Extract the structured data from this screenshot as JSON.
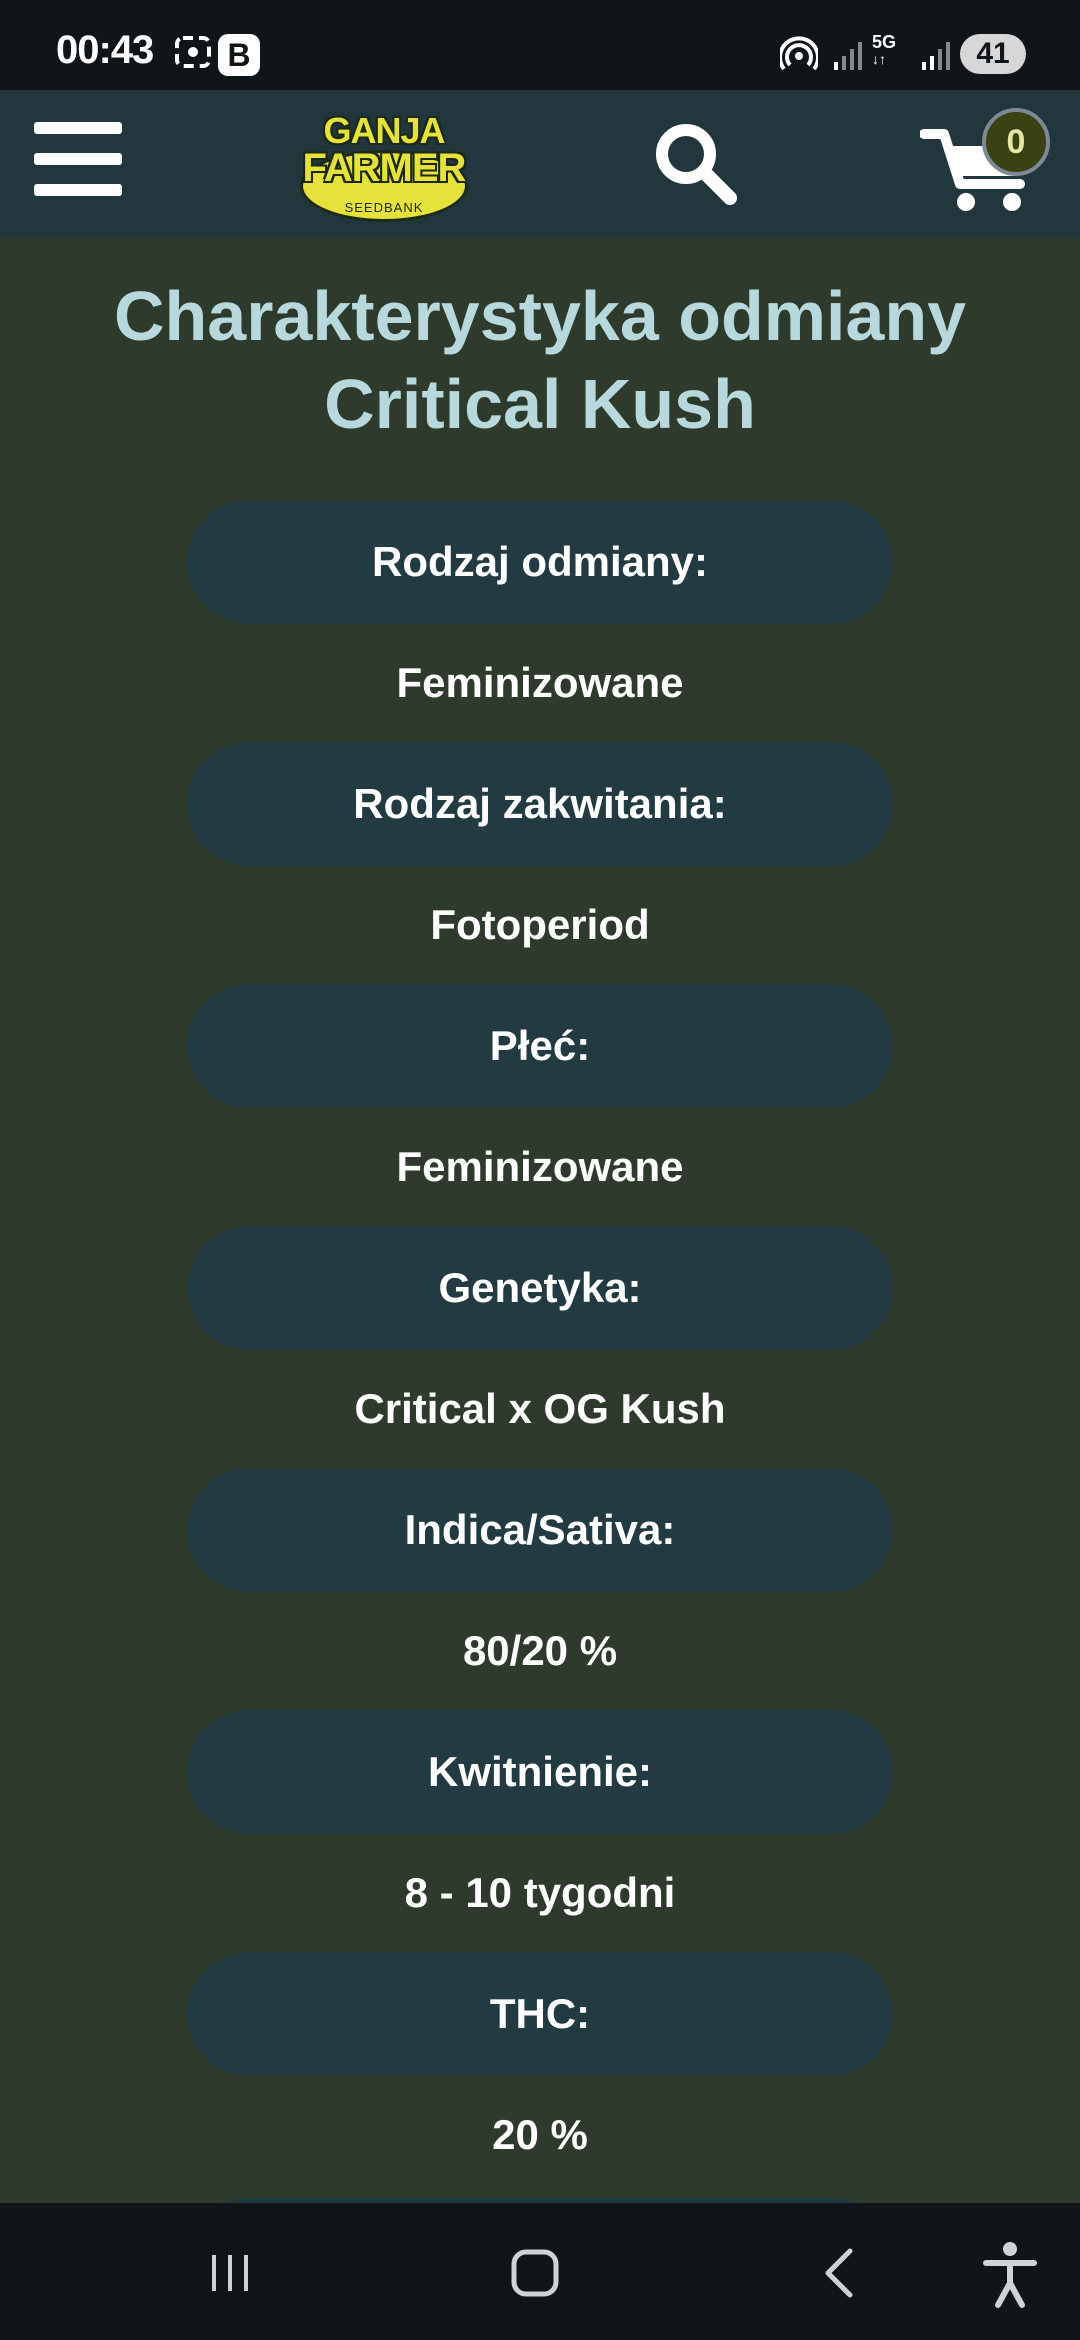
{
  "status_bar": {
    "time": "00:43",
    "app_badge": "B",
    "network": "5G",
    "battery": "41",
    "icons": [
      "screenshot-icon",
      "app-b-icon",
      "hotspot-icon",
      "signal-icon",
      "signal-icon",
      "battery-icon"
    ]
  },
  "header": {
    "logo_line1": "GANJA",
    "logo_line2": "FARMER",
    "logo_sub": "SEEDBANK",
    "cart_count": "0",
    "icons": [
      "menu-icon",
      "search-icon",
      "cart-icon"
    ]
  },
  "main": {
    "title_line1": "Charakterystyka odmiany",
    "title_line2": "Critical Kush",
    "specs": [
      {
        "label": "Rodzaj odmiany:",
        "value": "Feminizowane"
      },
      {
        "label": "Rodzaj zakwitania:",
        "value": "Fotoperiod"
      },
      {
        "label": "Płeć:",
        "value": "Feminizowane"
      },
      {
        "label": "Genetyka:",
        "value": "Critical x OG Kush"
      },
      {
        "label": "Indica/Sativa:",
        "value": "80/20 %"
      },
      {
        "label": "Kwitnienie:",
        "value": "8 - 10 tygodni"
      },
      {
        "label": "THC:",
        "value": "20 %"
      }
    ]
  },
  "nav_bar": {
    "icons": [
      "recent-apps-icon",
      "home-icon",
      "back-icon",
      "accessibility-icon"
    ]
  },
  "colors": {
    "page_bg": "#2e3a2b",
    "header_bg": "#22363d",
    "pill_bg": "#223a42",
    "title": "#b7d8dc",
    "logo_yellow": "#e4e23b"
  }
}
